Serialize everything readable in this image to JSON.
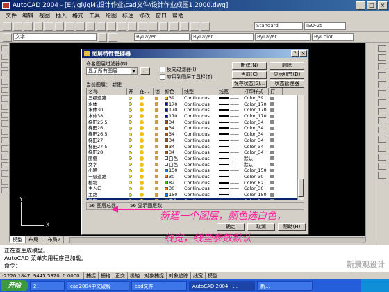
{
  "app": {
    "title": "AutoCAD 2004 - [E:\\lgl\\lgl4\\设计作业\\cad文件\\设计作业成图1 2000.dwg]"
  },
  "menubar": [
    "文件",
    "编辑",
    "视图",
    "插入",
    "格式",
    "工具",
    "绘图",
    "标注",
    "修改",
    "窗口",
    "帮助"
  ],
  "toolbar": {
    "layer_combo": "文字",
    "color_combo": "ByLayer",
    "linetype_combo": "ByLayer",
    "lineweight_combo": "ByLayer",
    "plotstyle_combo": "ByColor",
    "textstyle_combo": "Standard",
    "dimstyle_combo": "ISO-25"
  },
  "dialog": {
    "title": "图层特性管理器",
    "filter_label": "命名图层过滤器(N)",
    "filter_value": "显示所有图层",
    "dots_label": "...",
    "invert_filter": "反向过滤器(I)",
    "apply_toolbar": "应用到图层工具栏(T)",
    "buttons": {
      "new": "新建(N)",
      "delete": "删除",
      "current": "当前(C)",
      "show_details": "显示细节(D)",
      "save_state": "保存状态(S)...",
      "state_manager": "状态管理器(A)...",
      "ok": "确定",
      "cancel": "取消",
      "help": "帮助(H)"
    },
    "current_layer_label": "当前图层：",
    "current_layer_value": "新建",
    "columns": [
      "名称",
      "开",
      "在...",
      "锁",
      "颜色",
      "线型",
      "线宽",
      "打印样式",
      "打"
    ],
    "layers": [
      {
        "name": "三级道路",
        "color": "39",
        "color_hex": "#ffbf00",
        "linetype": "Continuous",
        "lineweight": "——",
        "plotstyle": "Color_39"
      },
      {
        "name": "水体",
        "color": "170",
        "color_hex": "#0000a0",
        "linetype": "Continuous",
        "lineweight": "——",
        "plotstyle": "Color_170"
      },
      {
        "name": "水体30",
        "color": "170",
        "color_hex": "#0000a0",
        "linetype": "Continuous",
        "lineweight": "——",
        "plotstyle": "Color_170"
      },
      {
        "name": "水体38",
        "color": "170",
        "color_hex": "#0000a0",
        "linetype": "Continuous",
        "lineweight": "——",
        "plotstyle": "Color_170"
      },
      {
        "name": "梯田25.5",
        "color": "34",
        "color_hex": "#a05000",
        "linetype": "Continuous",
        "lineweight": "——",
        "plotstyle": "Color_34"
      },
      {
        "name": "梯田26",
        "color": "34",
        "color_hex": "#a05000",
        "linetype": "Continuous",
        "lineweight": "——",
        "plotstyle": "Color_34"
      },
      {
        "name": "梯田26.5",
        "color": "34",
        "color_hex": "#a05000",
        "linetype": "Continuous",
        "lineweight": "——",
        "plotstyle": "Color_34"
      },
      {
        "name": "梯田27",
        "color": "34",
        "color_hex": "#a05000",
        "linetype": "Continuous",
        "lineweight": "——",
        "plotstyle": "Color_34"
      },
      {
        "name": "梯田27.5",
        "color": "34",
        "color_hex": "#a05000",
        "linetype": "Continuous",
        "lineweight": "——",
        "plotstyle": "Color_34"
      },
      {
        "name": "梯田28",
        "color": "34",
        "color_hex": "#a05000",
        "linetype": "Continuous",
        "lineweight": "——",
        "plotstyle": "Color_34"
      },
      {
        "name": "图框",
        "color": "白色",
        "color_hex": "#ffffff",
        "linetype": "Continuous",
        "lineweight": "——",
        "plotstyle": "默认"
      },
      {
        "name": "文字",
        "color": "白色",
        "color_hex": "#ffffff",
        "linetype": "Continuous",
        "lineweight": "——",
        "plotstyle": "默认"
      },
      {
        "name": "小路",
        "color": "150",
        "color_hex": "#0080ff",
        "linetype": "Continuous",
        "lineweight": "——",
        "plotstyle": "Color_150"
      },
      {
        "name": "一级道路",
        "color": "30",
        "color_hex": "#ff7f00",
        "linetype": "Continuous",
        "lineweight": "——",
        "plotstyle": "Color_30"
      },
      {
        "name": "植物",
        "color": "82",
        "color_hex": "#3fbf00",
        "linetype": "Continuous",
        "lineweight": "——",
        "plotstyle": "Color_82"
      },
      {
        "name": "主入口",
        "color": "30",
        "color_hex": "#ff7f00",
        "linetype": "Continuous",
        "lineweight": "——",
        "plotstyle": "Color_30"
      },
      {
        "name": "主路",
        "color": "150",
        "color_hex": "#0080ff",
        "linetype": "Continuous",
        "lineweight": "——",
        "plotstyle": "Color_150"
      },
      {
        "name": "新图",
        "color": "白色",
        "color_hex": "#ffffff",
        "linetype": "Continuous",
        "lineweight": "——",
        "plotstyle": "Color_7",
        "selected": true
      }
    ],
    "status_total": "56 图层总数",
    "status_shown": "56 显示图层数"
  },
  "annotation": {
    "line1": "新建一个图层，颜色选白色，",
    "line2": "线宽，线型参数默认",
    "color": "#ff20a0"
  },
  "layout_tabs": [
    "模型",
    "布局1",
    "布局2"
  ],
  "command": {
    "line1": "正在重生成模型。",
    "line2": "AutoCAD 菜单实用程序已加载。",
    "prompt": "命令："
  },
  "status": {
    "coords": "-2220.1847, 9445.5320, 0.0000",
    "toggles": [
      "捕捉",
      "栅格",
      "正交",
      "极轴",
      "对象捕捉",
      "对象追踪",
      "线宽",
      "模型"
    ]
  },
  "taskbar": {
    "start": "开始",
    "items": [
      "2",
      "cad2004中文破解",
      "cad文件",
      "AutoCAD 2004 - ...",
      "新..."
    ]
  },
  "watermark": "新景观设计"
}
